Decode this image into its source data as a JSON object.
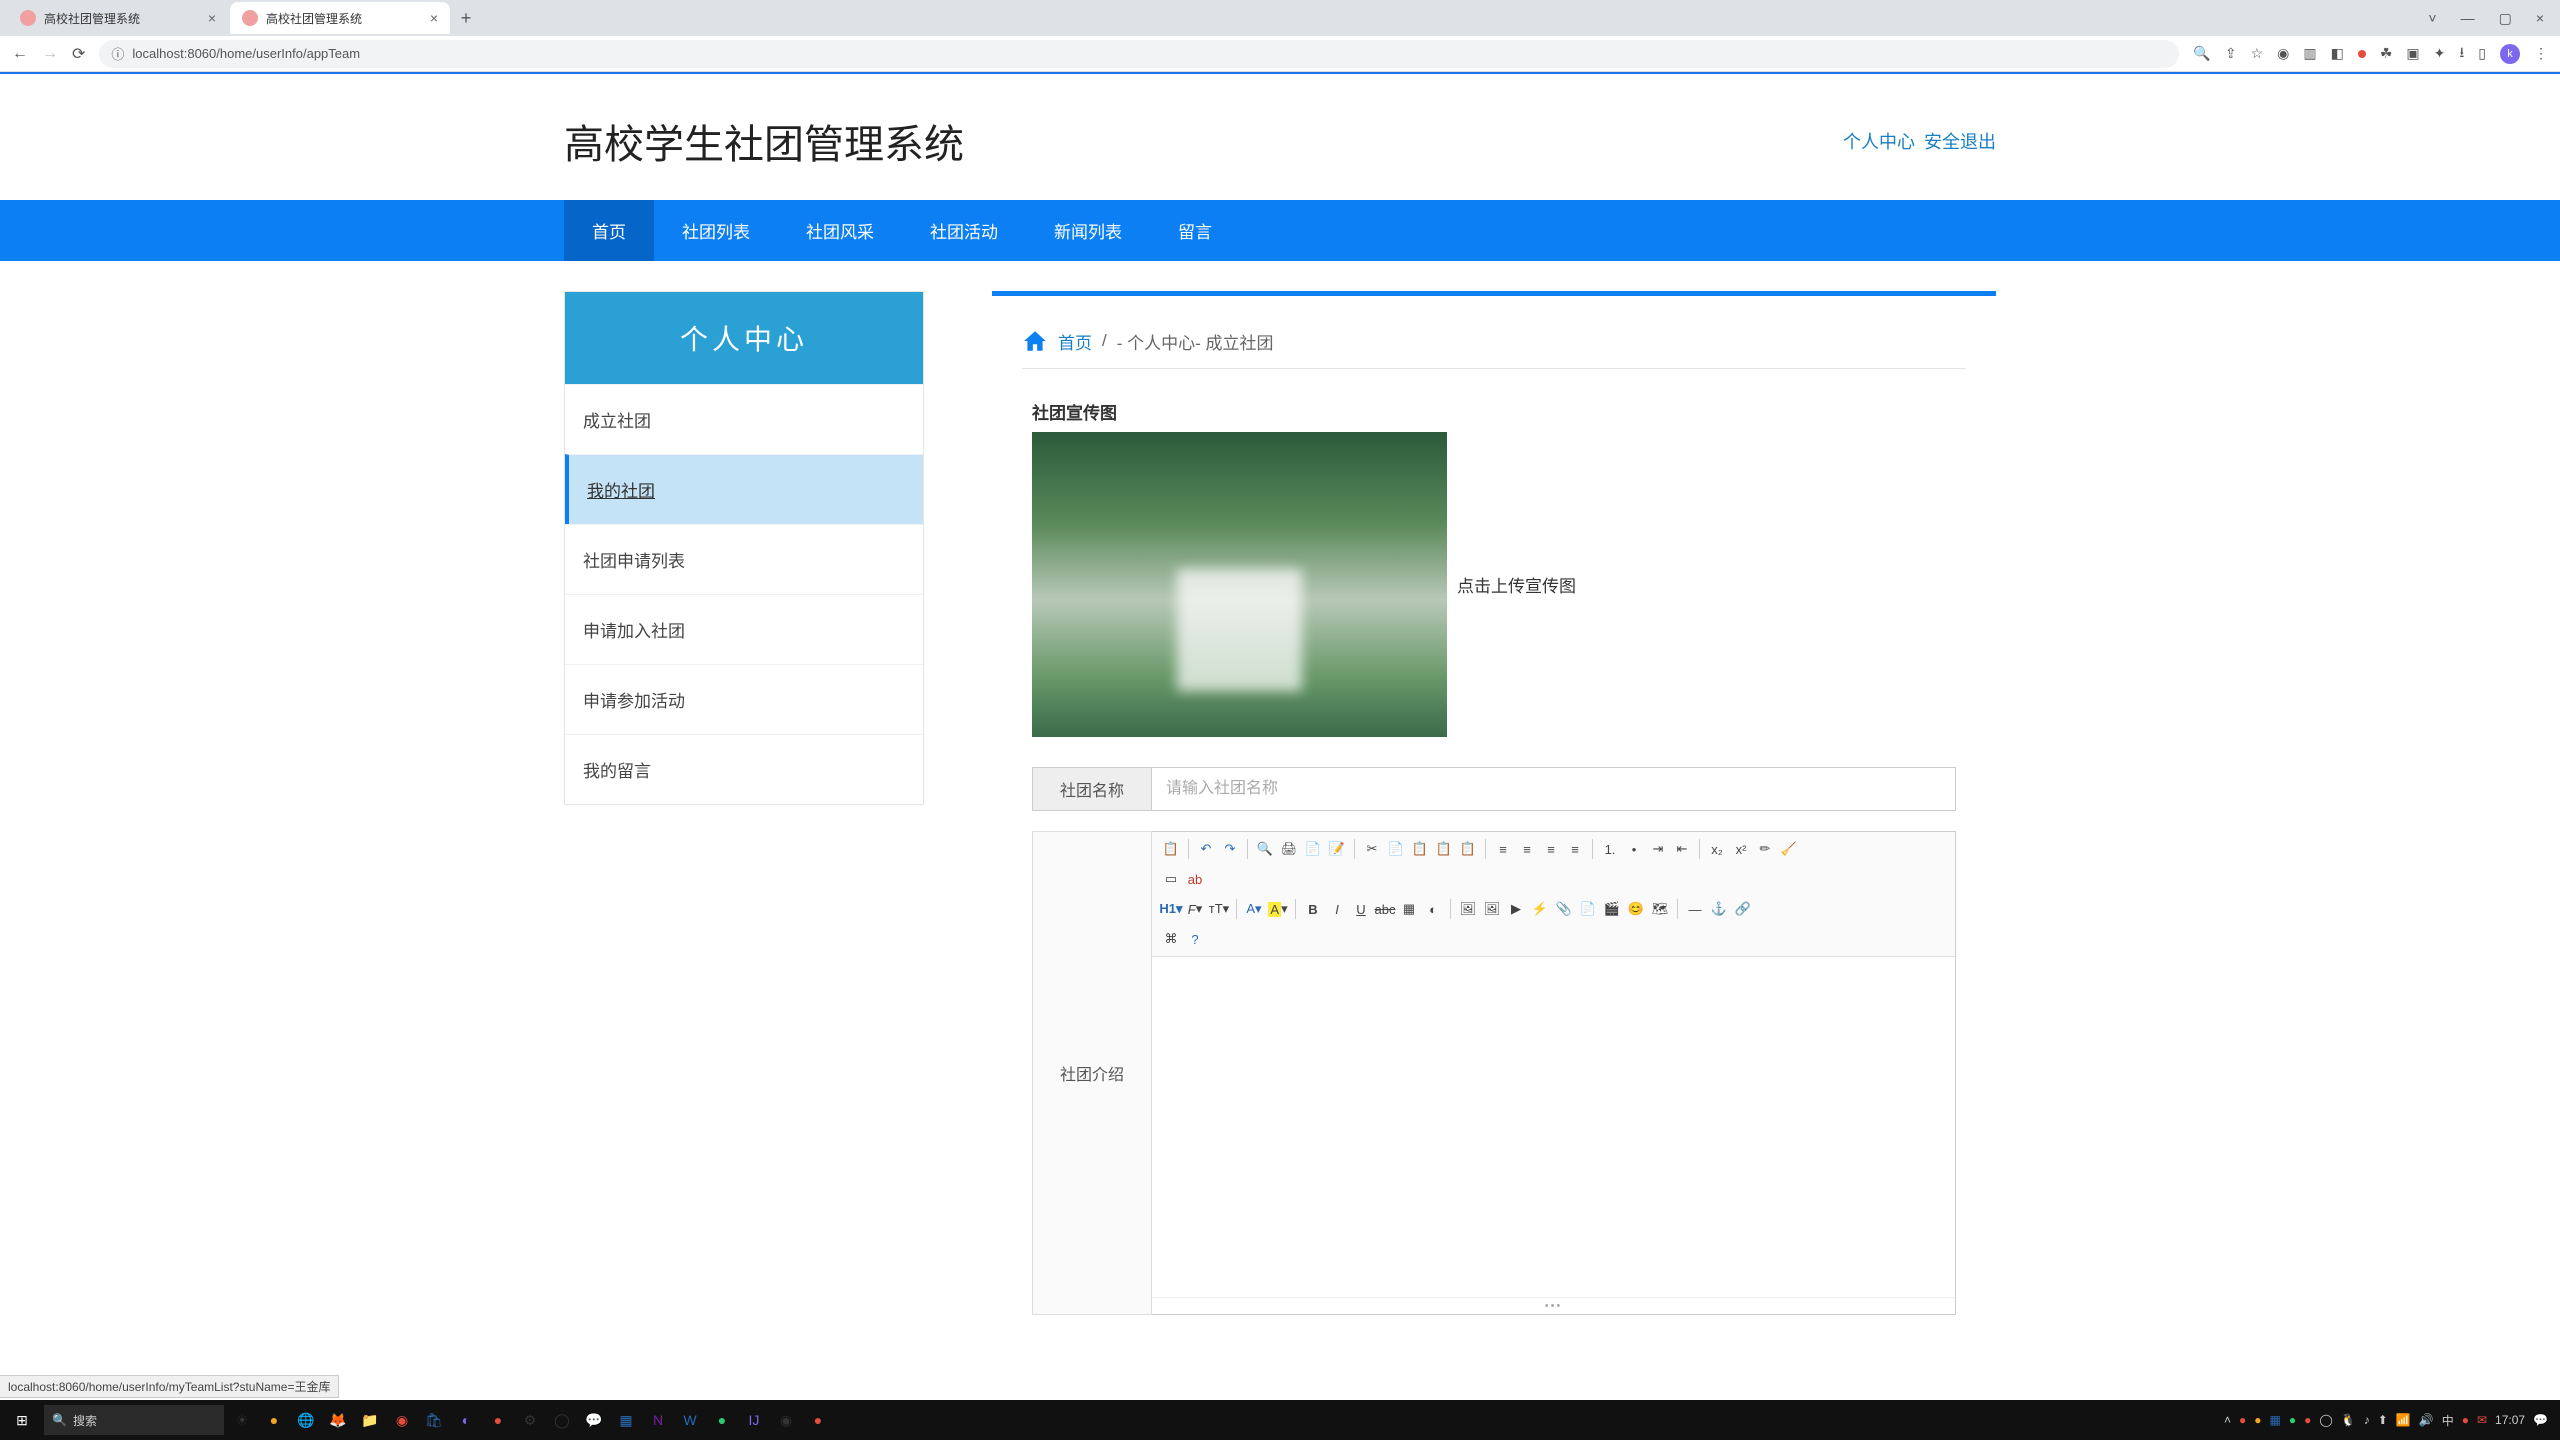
{
  "browser": {
    "tabs": [
      {
        "title": "高校社团管理系统",
        "active": false
      },
      {
        "title": "高校社团管理系统",
        "active": true
      }
    ],
    "url": "localhost:8060/home/userInfo/appTeam"
  },
  "header": {
    "title": "高校学生社团管理系统",
    "link_profile": "个人中心",
    "link_logout": "安全退出"
  },
  "nav": {
    "items": [
      "首页",
      "社团列表",
      "社团风采",
      "社团活动",
      "新闻列表",
      "留言"
    ],
    "active_index": 0
  },
  "sidebar": {
    "title": "个人中心",
    "items": [
      "成立社团",
      "我的社团",
      "社团申请列表",
      "申请加入社团",
      "申请参加活动",
      "我的留言"
    ],
    "active_index": 1
  },
  "breadcrumb": {
    "home": "首页",
    "sep": "/",
    "rest": "- 个人中心- 成立社团"
  },
  "form": {
    "image_label": "社团宣传图",
    "upload_hint": "点击上传宣传图",
    "name_label": "社团名称",
    "name_placeholder": "请输入社团名称",
    "intro_label": "社团介绍"
  },
  "status_url": "localhost:8060/home/userInfo/myTeamList?stuName=王金库",
  "taskbar": {
    "search_placeholder": "搜索",
    "time": "17:07"
  }
}
